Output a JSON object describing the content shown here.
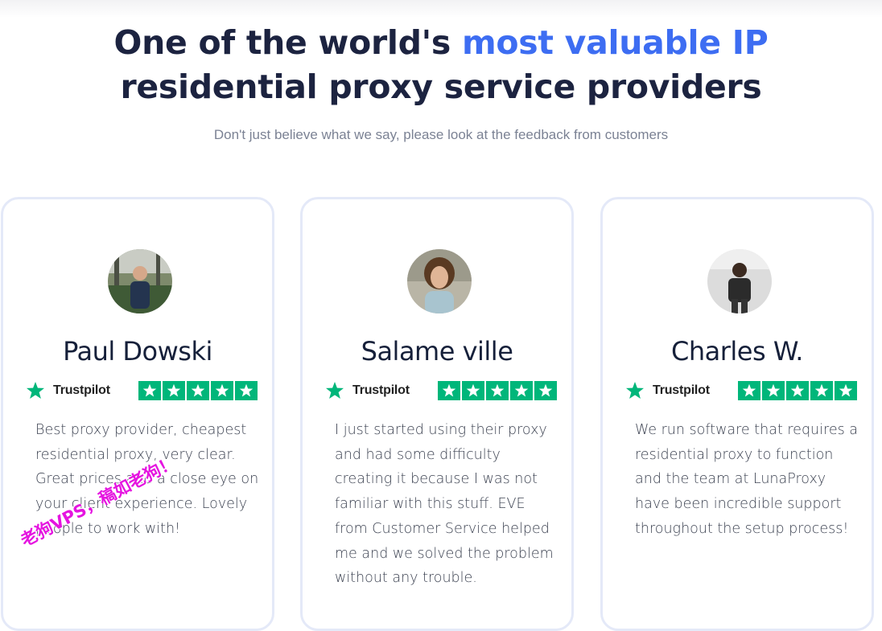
{
  "header": {
    "title_part1": "One of the world's ",
    "title_accent": "most valuable IP",
    "title_part2": "residential proxy service providers",
    "subtitle": "Don't just believe what we say, please look at the feedback from customers",
    "accent_color": "#3d6df2"
  },
  "reviews": [
    {
      "name": "Paul Dowski",
      "platform": "Trustpilot",
      "rating": 5,
      "quote": "Best proxy provider, cheapest residential proxy, very clear. Great prices and a close eye on your client experience. Lovely people to work with!"
    },
    {
      "name": "Salame ville",
      "platform": "Trustpilot",
      "rating": 5,
      "quote": "I just started using their proxy and had some difficulty creating it because I was not familiar with this stuff. EVE from Customer Service helped me and we solved the problem without any trouble."
    },
    {
      "name": "Charles W.",
      "platform": "Trustpilot",
      "rating": 5,
      "quote": "We run software that requires a residential proxy to function and the team at LunaProxy have been incredible support throughout the setup process!"
    }
  ],
  "trustpilot_color": "#00b67a",
  "watermark": "老狗VPS，稿如老狗！"
}
